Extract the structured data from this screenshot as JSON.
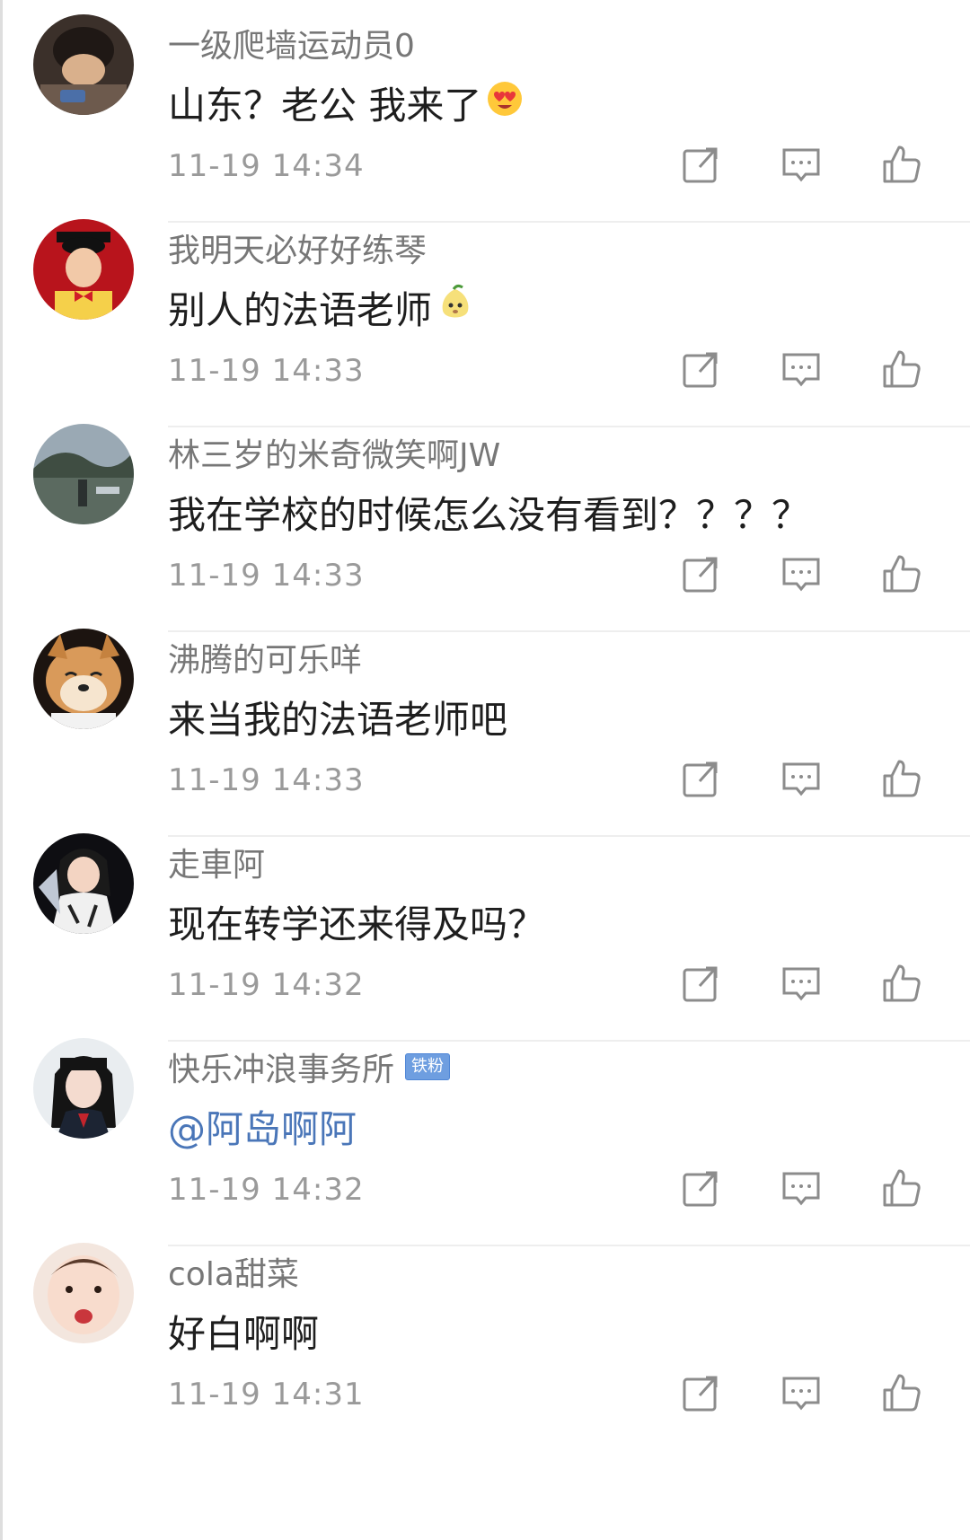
{
  "comments": [
    {
      "username": "一级爬墙运动员0",
      "text": "山东？老公 我来了",
      "emoji": "heart-eyes-emoji",
      "time": "11-19 14:34",
      "badge": "",
      "avatar": "child-lying-avatar"
    },
    {
      "username": "我明天必好好练琴",
      "text": "别人的法语老师",
      "emoji": "pear-face-emoji",
      "time": "11-19 14:33",
      "badge": "",
      "avatar": "graduate-boy-avatar"
    },
    {
      "username": "林三岁的米奇微笑啊JW",
      "text": "我在学校的时候怎么没有看到？？？？",
      "emoji": "",
      "time": "11-19 14:33",
      "badge": "",
      "avatar": "street-photo-avatar"
    },
    {
      "username": "沸腾的可乐咩",
      "text": "来当我的法语老师吧",
      "emoji": "",
      "time": "11-19 14:33",
      "badge": "",
      "avatar": "shiba-dog-avatar"
    },
    {
      "username": "走車阿",
      "text": "现在转学还来得及吗？",
      "emoji": "",
      "time": "11-19 14:32",
      "badge": "",
      "avatar": "anime-girl-avatar"
    },
    {
      "username": "快乐冲浪事务所",
      "text": "@阿岛啊阿",
      "emoji": "",
      "time": "11-19 14:32",
      "badge": "铁粉",
      "mention": true,
      "avatar": "schoolgirl-avatar"
    },
    {
      "username": "cola甜菜",
      "text": "好白啊啊",
      "emoji": "",
      "time": "11-19 14:31",
      "badge": "",
      "avatar": "baby-face-avatar"
    }
  ],
  "colors": {
    "username": "#777777",
    "text": "#1e1e1e",
    "time": "#9a9a9a",
    "mention": "#4a76b8",
    "badge_bg": "#6e9ee0",
    "icon": "#8c8c8c",
    "divider": "#eeeeee"
  },
  "icons": {
    "repost": "repost-icon",
    "reply": "reply-icon",
    "like": "like-icon"
  }
}
